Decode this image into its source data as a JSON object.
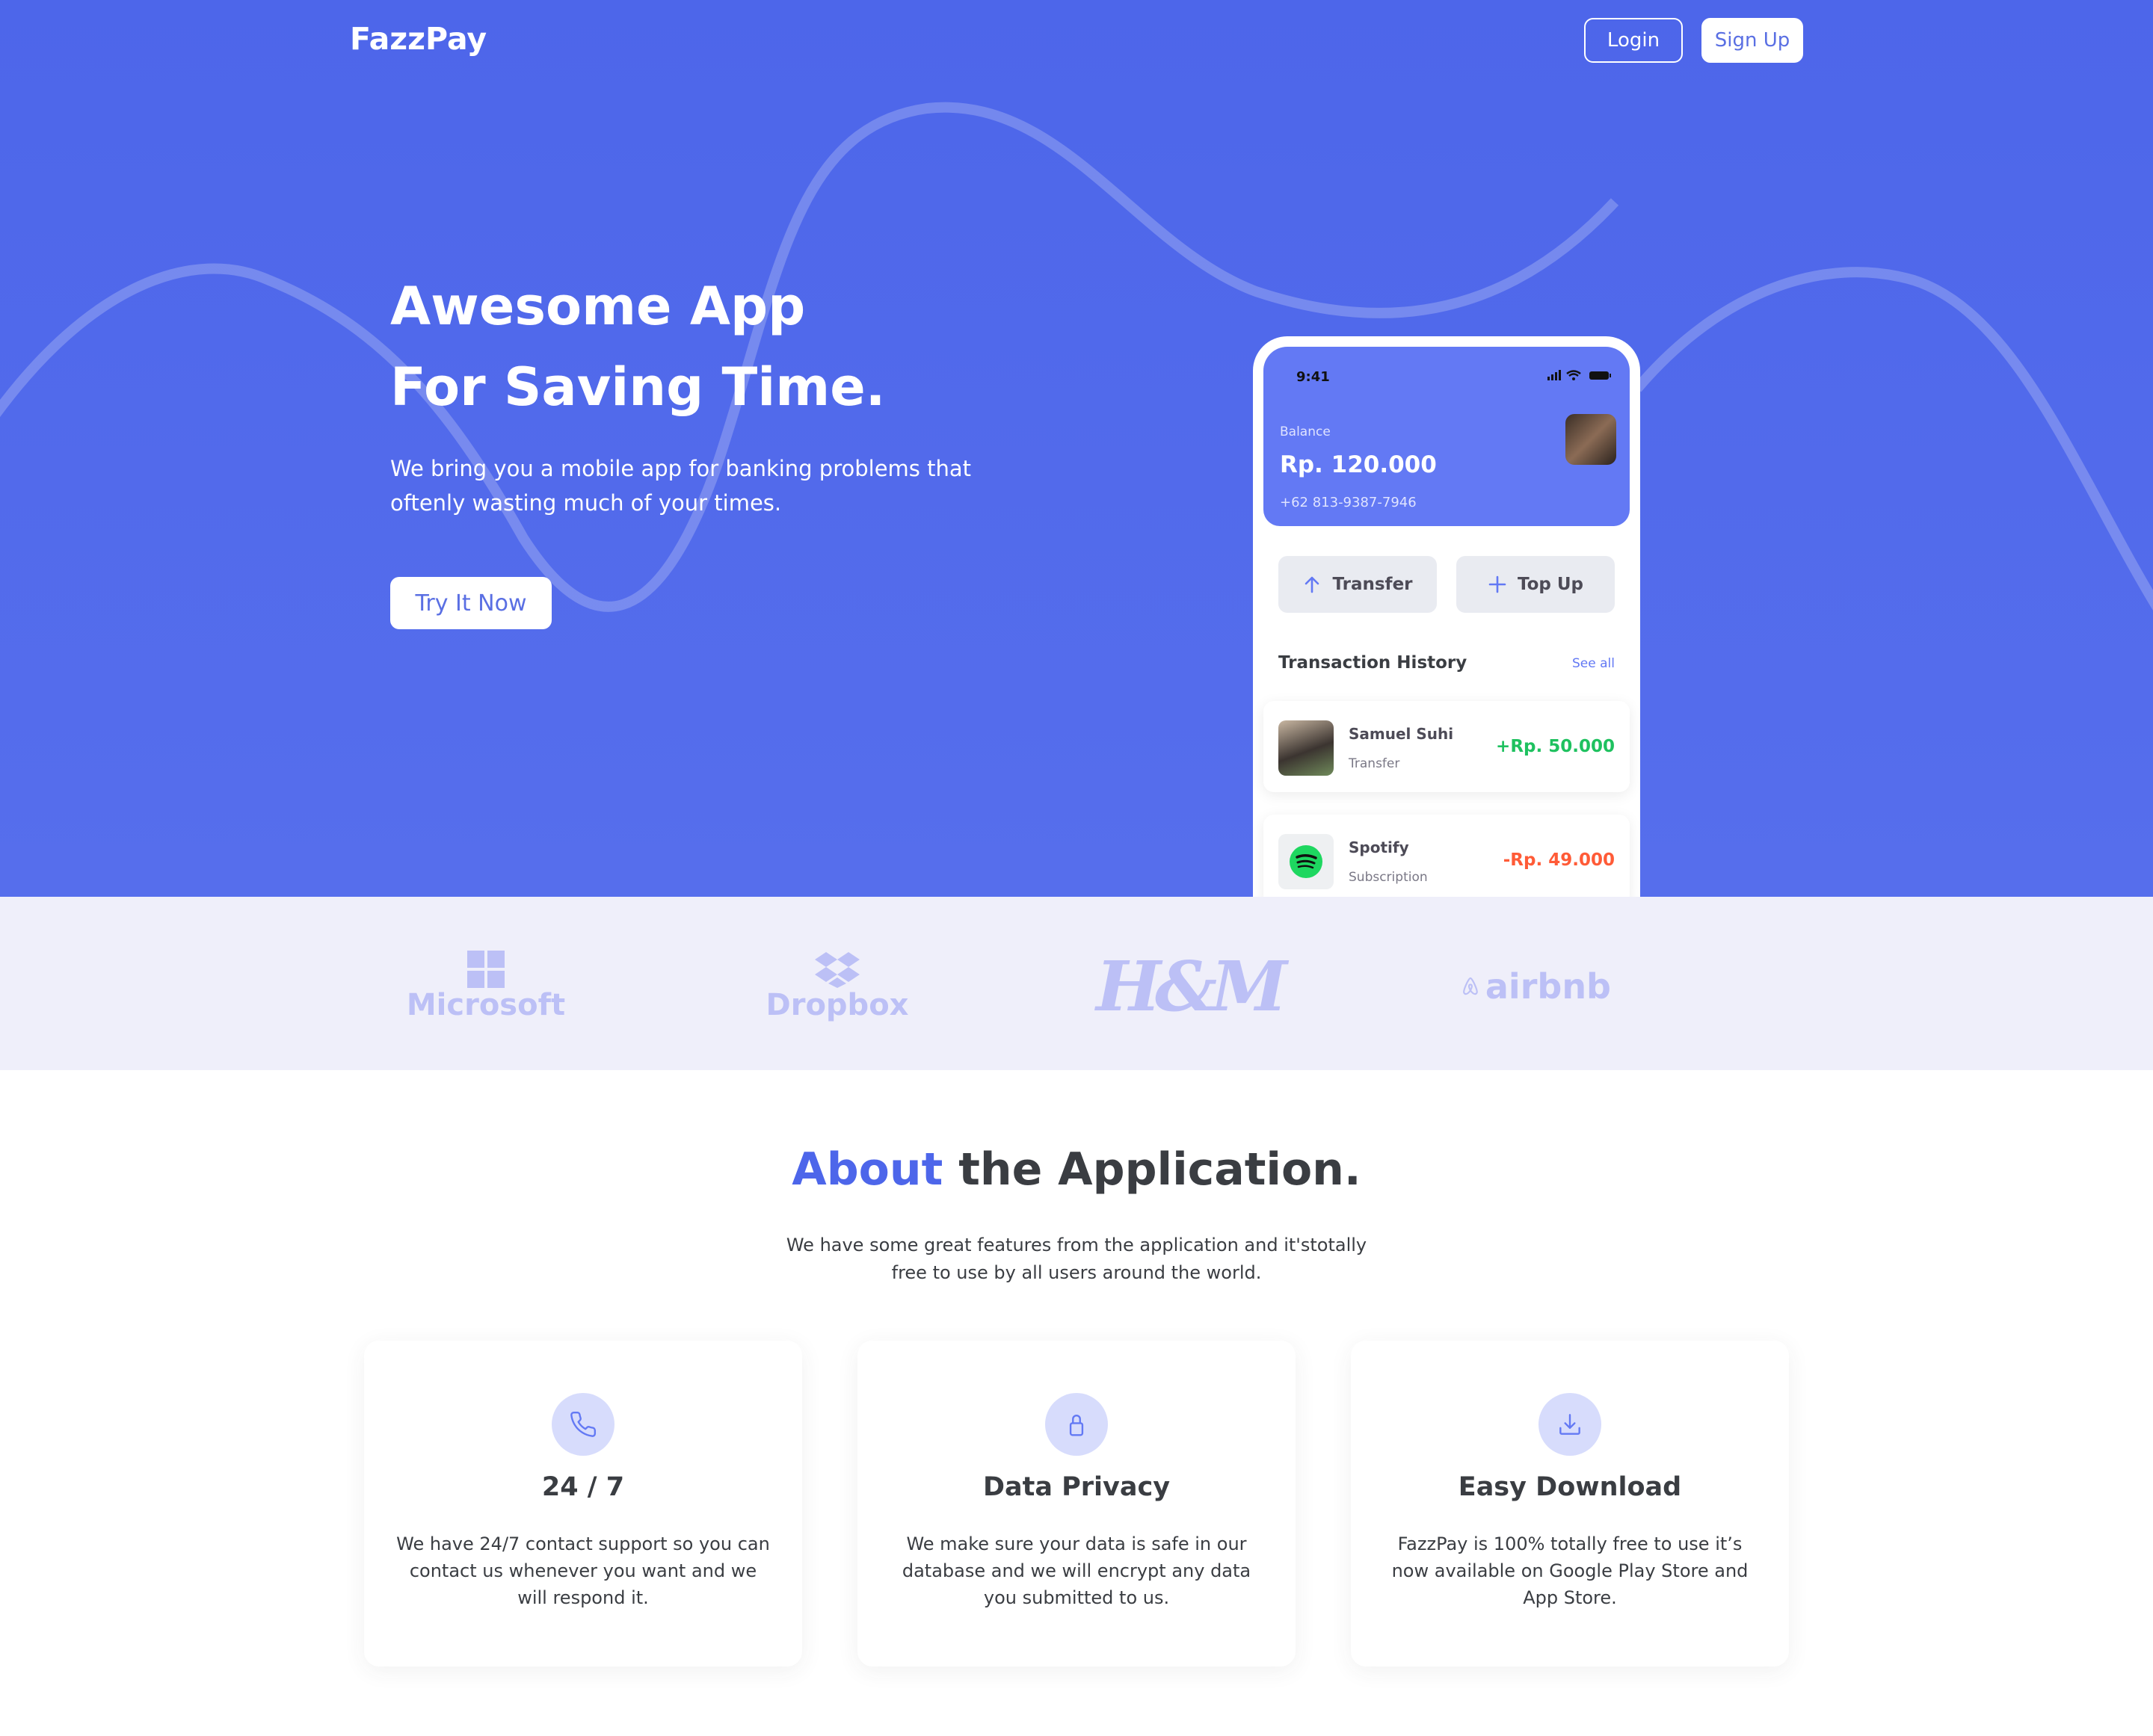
{
  "nav": {
    "logo": "FazzPay",
    "login_label": "Login",
    "signup_label": "Sign Up"
  },
  "hero": {
    "title_line1": "Awesome App",
    "title_line2": "For Saving Time.",
    "description": "We bring you a mobile app for banking problems that oftenly wasting much of your times.",
    "cta_label": "Try It Now"
  },
  "phone": {
    "time": "9:41",
    "balance_label": "Balance",
    "balance_amount": "Rp. 120.000",
    "phone_number": "+62 813-9387-7946",
    "transfer_label": "Transfer",
    "topup_label": "Top Up",
    "history_title": "Transaction History",
    "see_all_label": "See all",
    "transactions": [
      {
        "name": "Samuel Suhi",
        "type": "Transfer",
        "amount": "+Rp. 50.000"
      },
      {
        "name": "Spotify",
        "type": "Subscription",
        "amount": "-Rp. 49.000"
      }
    ]
  },
  "partners": {
    "names": [
      "Microsoft",
      "Dropbox",
      "H&M",
      "airbnb"
    ]
  },
  "about": {
    "title_accent": "About",
    "title_rest": " the Application.",
    "description": "We have some great features from the application and it'stotally free to use by all users around the world.",
    "features": [
      {
        "icon": "phone-icon",
        "title": "24 / 7",
        "description": "We have 24/7 contact support so you can contact us whenever you want and we will respond it."
      },
      {
        "icon": "lock-icon",
        "title": "Data Privacy",
        "description": "We make sure your data is safe in our database and we will encrypt any data you submitted to us."
      },
      {
        "icon": "download-icon",
        "title": "Easy Download",
        "description": "FazzPay is 100% totally free to use it’s now available on Google Play Store and App Store."
      }
    ]
  },
  "colors": {
    "primary": "#4d66ea",
    "positive": "#1ec15f",
    "negative": "#ff5b37",
    "partner_logo": "#bcc0f6"
  }
}
